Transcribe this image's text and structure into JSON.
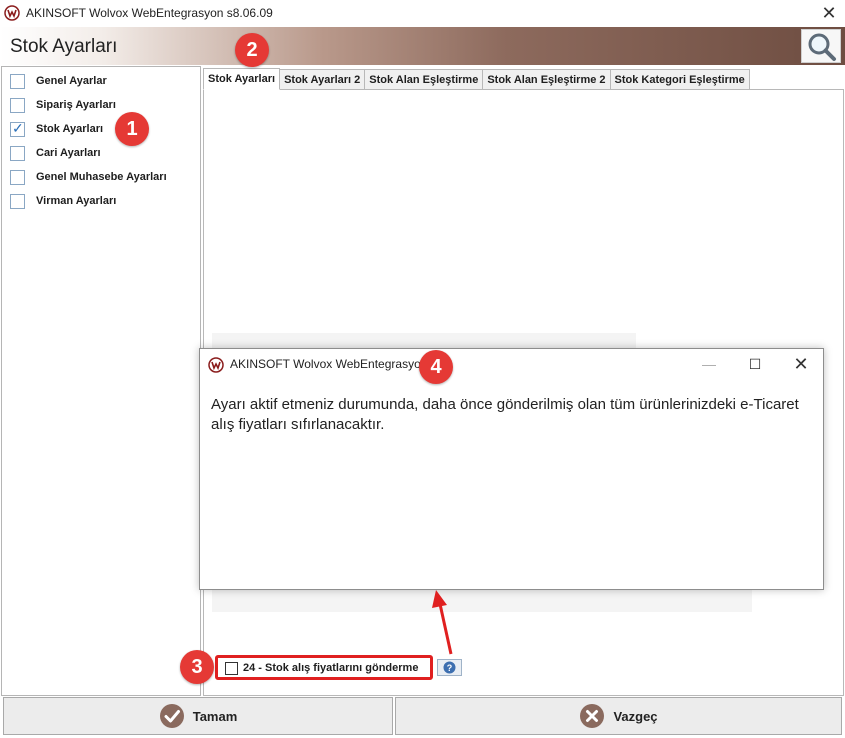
{
  "window": {
    "title": "AKINSOFT Wolvox WebEntegrasyon s8.06.09"
  },
  "header": {
    "title": "Stok Ayarları"
  },
  "sidebar": {
    "items": [
      {
        "label": "Genel Ayarlar",
        "checked": false
      },
      {
        "label": "Sipariş Ayarları",
        "checked": false
      },
      {
        "label": "Stok Ayarları",
        "checked": true
      },
      {
        "label": "Cari Ayarları",
        "checked": false
      },
      {
        "label": "Genel Muhasebe Ayarları",
        "checked": false
      },
      {
        "label": "Virman Ayarları",
        "checked": false
      }
    ]
  },
  "tabs": [
    {
      "label": "Stok Ayarları",
      "active": true
    },
    {
      "label": "Stok Ayarları 2",
      "active": false
    },
    {
      "label": "Stok Alan Eşleştirme",
      "active": false
    },
    {
      "label": "Stok Alan Eşleştirme 2",
      "active": false
    },
    {
      "label": "Stok Kategori Eşleştirme",
      "active": false
    }
  ],
  "dialog": {
    "title": "AKINSOFT Wolvox WebEntegrasyon",
    "message": "Ayarı aktif etmeniz durumunda, daha önce gönderilmiş olan tüm ürünlerinizdeki e-Ticaret alış fiyatları sıfırlanacaktır."
  },
  "option": {
    "label": "24 - Stok alış fiyatlarını gönderme",
    "checked": false
  },
  "buttons": {
    "ok_label": "Tamam",
    "cancel_label": "Vazgeç"
  },
  "markers": [
    "1",
    "2",
    "3",
    "4"
  ],
  "colors": {
    "marker": "#e53935",
    "highlight_border": "#e02020",
    "header_dark": "#6e4d41"
  },
  "icons": [
    "app-icon",
    "close-icon",
    "search-icon",
    "checkbox-icon",
    "help-icon",
    "ok-check-icon",
    "cancel-x-icon"
  ]
}
